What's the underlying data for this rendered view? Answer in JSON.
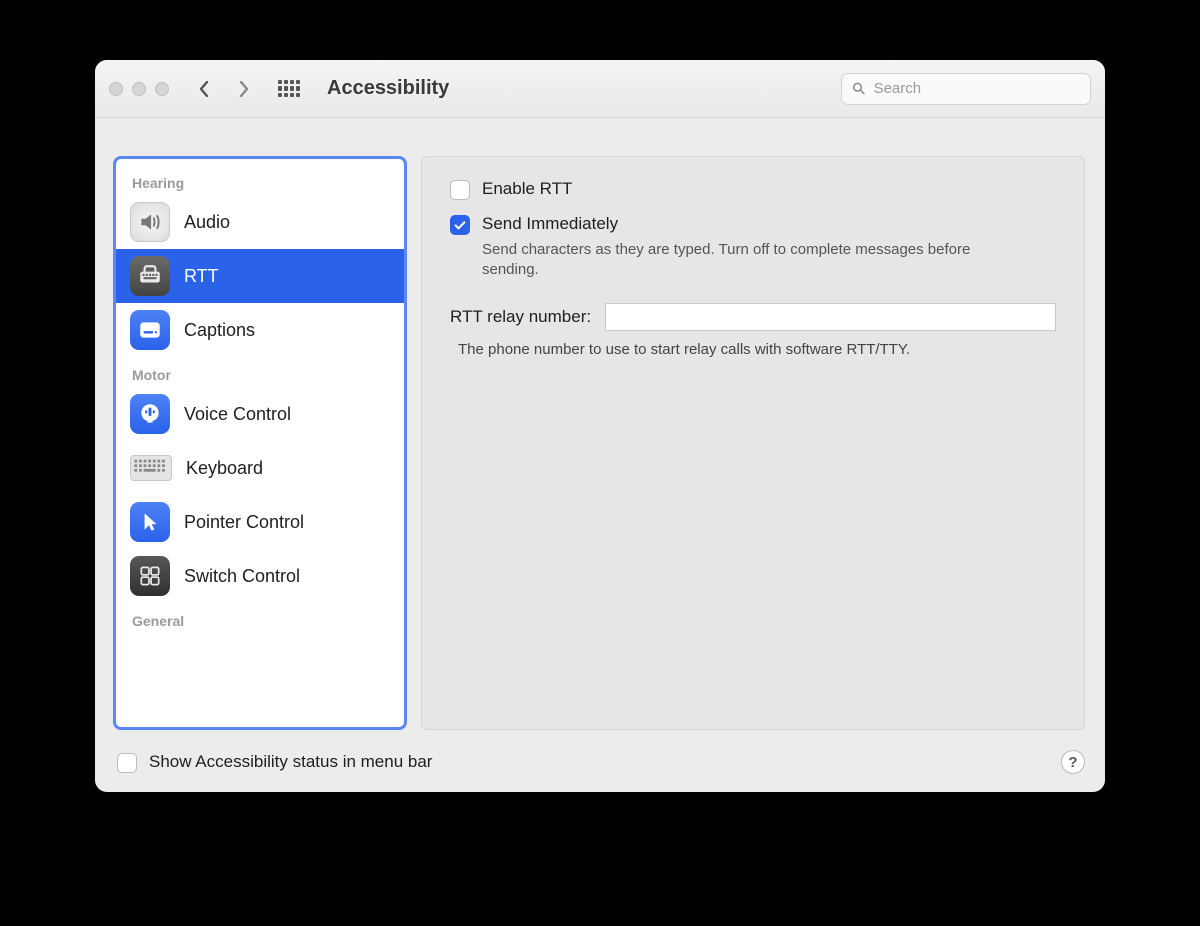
{
  "toolbar": {
    "title": "Accessibility",
    "search_placeholder": "Search"
  },
  "sidebar": {
    "sections": [
      {
        "label": "Hearing",
        "items": [
          {
            "label": "Audio",
            "icon": "audio-icon",
            "selected": false
          },
          {
            "label": "RTT",
            "icon": "rtt-icon",
            "selected": true
          },
          {
            "label": "Captions",
            "icon": "captions-icon",
            "selected": false
          }
        ]
      },
      {
        "label": "Motor",
        "items": [
          {
            "label": "Voice Control",
            "icon": "voice-control-icon",
            "selected": false
          },
          {
            "label": "Keyboard",
            "icon": "keyboard-icon",
            "selected": false
          },
          {
            "label": "Pointer Control",
            "icon": "pointer-control-icon",
            "selected": false
          },
          {
            "label": "Switch Control",
            "icon": "switch-control-icon",
            "selected": false
          }
        ]
      },
      {
        "label": "General",
        "items": []
      }
    ]
  },
  "panel": {
    "enable_rtt": {
      "label": "Enable RTT",
      "checked": false
    },
    "send_immediately": {
      "label": "Send Immediately",
      "checked": true,
      "description": "Send characters as they are typed. Turn off to complete messages before sending."
    },
    "relay": {
      "label": "RTT relay number:",
      "value": "",
      "description": "The phone number to use to start relay calls with software RTT/TTY."
    }
  },
  "footer": {
    "show_status_label": "Show Accessibility status in menu bar",
    "show_status_checked": false,
    "help_label": "?"
  }
}
